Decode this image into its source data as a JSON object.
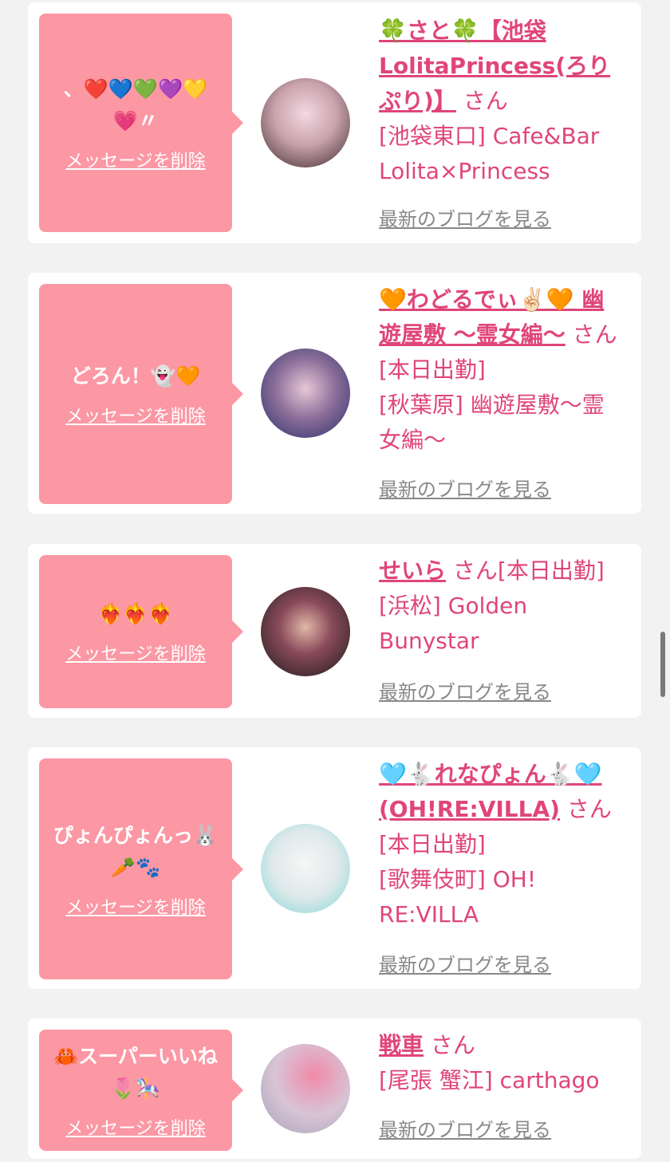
{
  "cards": [
    {
      "message": "、❤️💙💚💜💛\n💗〃",
      "delete_label": "メッセージを削除",
      "name": "🍀さと🍀【池袋LolitaPrincess(ろりぷり)】",
      "suffix": "さん",
      "store": "[池袋東口] Cafe&Bar Lolita×Princess",
      "blog_label": "最新のブログを見る",
      "avatar_colors": [
        "#f3d9e1",
        "#3b2a2a"
      ]
    },
    {
      "message": "どろん！👻🧡",
      "delete_label": "メッセージを削除",
      "name": "🧡わどるでぃ✌🏻🧡 幽遊屋敷 〜霊女編〜",
      "suffix": "さん[本日出勤]",
      "store": "[秋葉原] 幽遊屋敷〜霊女編〜",
      "blog_label": "最新のブログを見る",
      "avatar_colors": [
        "#2a2f6a",
        "#e7c8d8"
      ]
    },
    {
      "message": "❤️‍🔥❤️‍🔥❤️‍🔥",
      "delete_label": "メッセージを削除",
      "name": "せいら",
      "suffix": "さん[本日出勤]",
      "store": "[浜松] Golden Bunystar",
      "blog_label": "最新のブログを見る",
      "avatar_colors": [
        "#1b1b1b",
        "#e08aa0"
      ]
    },
    {
      "message": "ぴょんぴょんっ🐰\n🥕🐾",
      "delete_label": "メッセージを削除",
      "name": "🩵🐇れなぴょん🐇🩵(OH!RE:VILLA)",
      "suffix": "さん[本日出勤]",
      "store": "[歌舞伎町] OH! RE:VILLA",
      "blog_label": "最新のブログを見る",
      "avatar_colors": [
        "#f6f6f6",
        "#7fd6d6"
      ]
    },
    {
      "message": "🦀スーパーいいね\n🌷🎠",
      "delete_label": "メッセージを削除",
      "name": "戦車",
      "suffix": "さん",
      "store": "[尾張 蟹江] carthago",
      "blog_label": "最新のブログを見る",
      "avatar_colors": [
        "#d8c4d6",
        "#f08aa8"
      ]
    }
  ]
}
